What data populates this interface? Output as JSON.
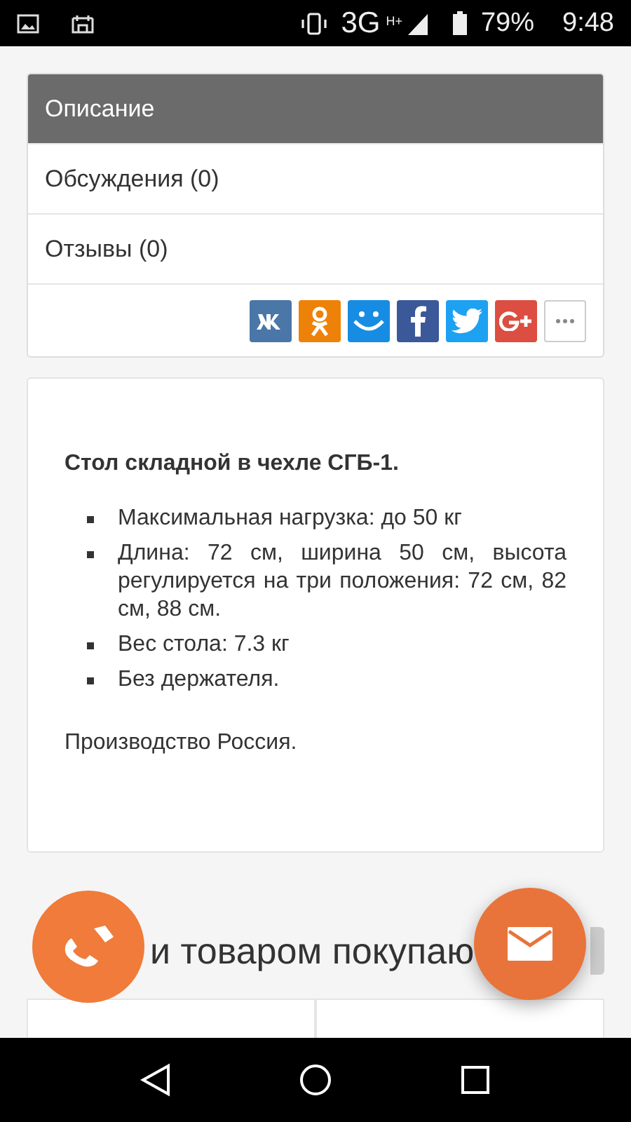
{
  "status_bar": {
    "network": "3G",
    "network_sub": "H+",
    "battery": "79%",
    "time": "9:48"
  },
  "tabs": [
    {
      "label": "Описание",
      "selected": true
    },
    {
      "label": "Обсуждения (0)",
      "selected": false
    },
    {
      "label": "Отзывы (0)",
      "selected": false
    }
  ],
  "share_buttons": [
    {
      "kind": "vk",
      "color": "#4a76a8"
    },
    {
      "kind": "ok",
      "color": "#ee8208"
    },
    {
      "kind": "mm",
      "color": "#168de2"
    },
    {
      "kind": "fb",
      "color": "#3b5998"
    },
    {
      "kind": "tw",
      "color": "#1da1f2"
    },
    {
      "kind": "gp",
      "color": "#dc4e41"
    },
    {
      "kind": "more",
      "color": "#ffffff"
    }
  ],
  "description": {
    "title": "Стол складной в чехле СГБ-1.",
    "bullets": [
      "Максимальная нагрузка: до 50 кг",
      "Длина: 72 см, ширина 50 см, высота регулируется на три положения: 72 см, 82 см, 88 см.",
      "Вес стола: 7.3 кг",
      "Без держателя."
    ],
    "footer": "Производство Россия."
  },
  "related": {
    "heading": "и товаром покупаю"
  }
}
